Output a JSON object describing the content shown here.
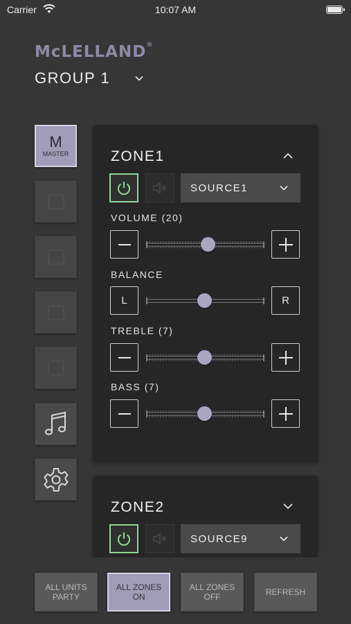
{
  "status_bar": {
    "carrier": "Carrier",
    "time": "10:07 AM",
    "wifi_icon": "wifi-icon",
    "battery_icon": "battery-icon"
  },
  "header": {
    "logo_text": "McLELLAND",
    "logo_mark": "®",
    "logo_color": "#8e8aa6",
    "group_label": "GROUP 1"
  },
  "sidebar": {
    "master": {
      "letter": "M",
      "label": "MASTER"
    },
    "zone_buttons": [
      "zone-1-icon",
      "zone-2-icon",
      "zone-3-icon",
      "zone-4-icon"
    ],
    "music_icon": "music-note-icon",
    "settings_icon": "gear-icon"
  },
  "zones": [
    {
      "title": "ZONE1",
      "expanded": true,
      "power": "on",
      "source": "SOURCE1",
      "volume_label": "VOLUME (20)",
      "volume_level": 0.52,
      "balance_label": "BALANCE",
      "balance_left": "L",
      "balance_right": "R",
      "balance_level": 0.49,
      "treble_label": "TREBLE (7)",
      "treble_level": 0.49,
      "bass_label": "BASS (7)",
      "bass_level": 0.49
    },
    {
      "title": "ZONE2",
      "expanded": false,
      "power": "on",
      "source": "SOURCE9"
    }
  ],
  "bottom_bar": {
    "all_units_party": "ALL UNITS\nPARTY",
    "all_zones_on": "ALL ZONES\nON",
    "all_zones_off": "ALL ZONES\nOFF",
    "refresh": "REFRESH"
  },
  "colors": {
    "background": "#363636",
    "panel": "#262626",
    "accent": "#a19cb8",
    "power_on": "#8fd698",
    "thumb": "#aaa6c2"
  }
}
